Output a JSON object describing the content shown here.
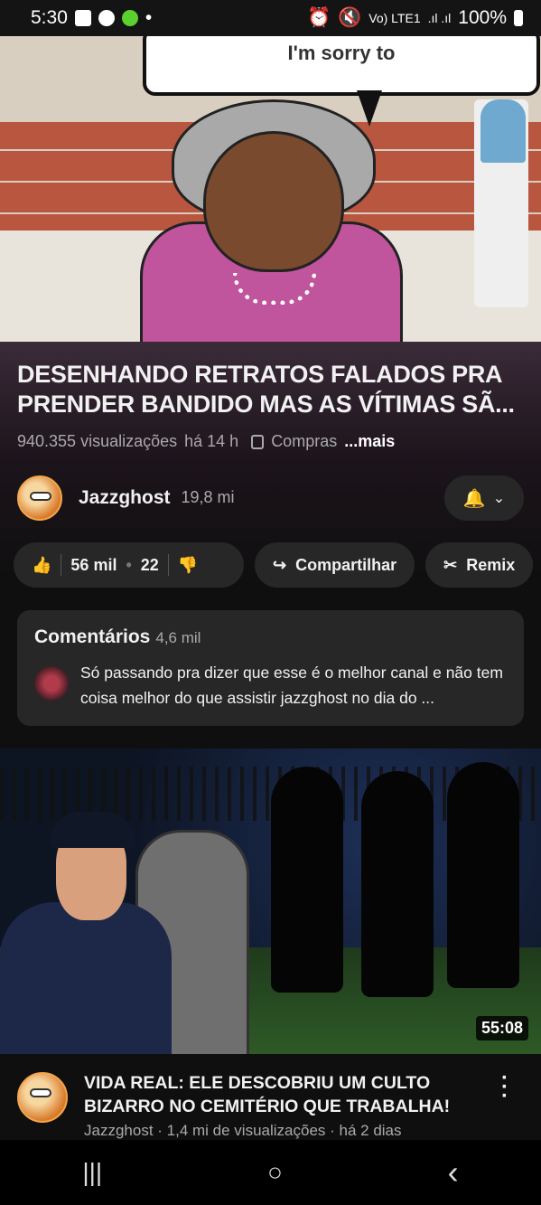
{
  "status_bar": {
    "time": "5:30",
    "battery": "100%"
  },
  "video": {
    "speech": "I'm sorry to"
  },
  "video_info": {
    "title": "DESENHANDO RETRATOS FALADOS PRA PRENDER BANDIDO MAS AS VÍTIMAS SÃ...",
    "views": "940.355 visualizações",
    "age": "há 14 h",
    "shopping": "Compras",
    "more": "...mais"
  },
  "channel": {
    "name": "Jazzghost",
    "subscribers": "19,8 mi"
  },
  "actions": {
    "likes": "56 mil",
    "dislikes": "22",
    "share": "Compartilhar",
    "remix": "Remix"
  },
  "comments": {
    "label": "Comentários",
    "count": "4,6 mil",
    "top_comment": "Só passando pra dizer que esse é o melhor canal e não tem coisa melhor do que assistir jazzghost no dia do ..."
  },
  "next_video": {
    "duration": "55:08",
    "title": "VIDA REAL: ELE DESCOBRIU UM CULTO BIZARRO NO CEMITÉRIO QUE TRABALHA!",
    "meta": "Jazzghost · 1,4 mi de visualizações · há 2 dias"
  },
  "nav": {
    "recent": "|||",
    "home": "○",
    "back": "‹"
  }
}
